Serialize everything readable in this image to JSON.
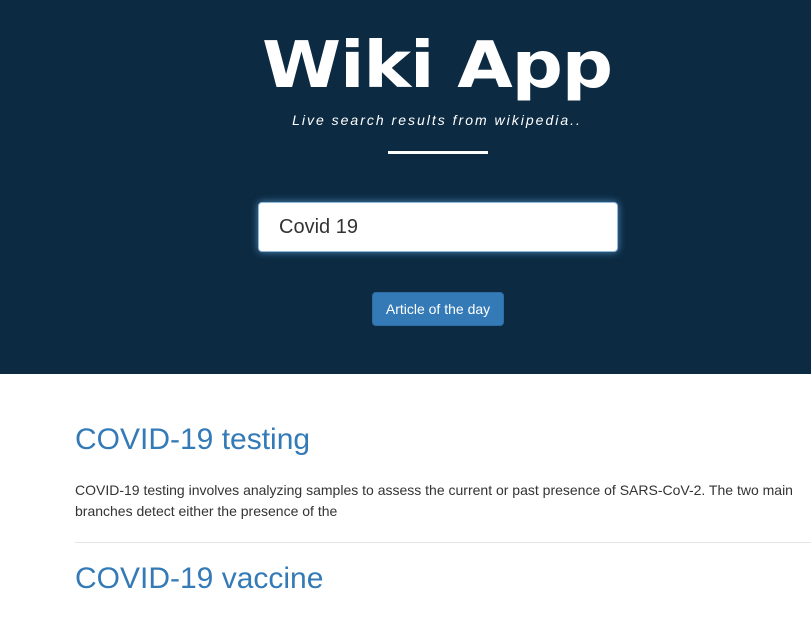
{
  "header": {
    "app_title": "Wiki App",
    "tagline": "Live search results from wikipedia.."
  },
  "search": {
    "value": "Covid 19"
  },
  "article_of_the_day_label": "Article of the day",
  "results": [
    {
      "title": "COVID-19 testing",
      "snippet": "COVID-19 testing involves analyzing samples to assess the current or past presence of SARS-CoV-2. The two main branches detect either the presence of the"
    },
    {
      "title": "COVID-19 vaccine",
      "snippet": ""
    }
  ],
  "colors": {
    "hero_background": "#0c2a42",
    "link": "#337ab7",
    "button": "#337ab7"
  }
}
